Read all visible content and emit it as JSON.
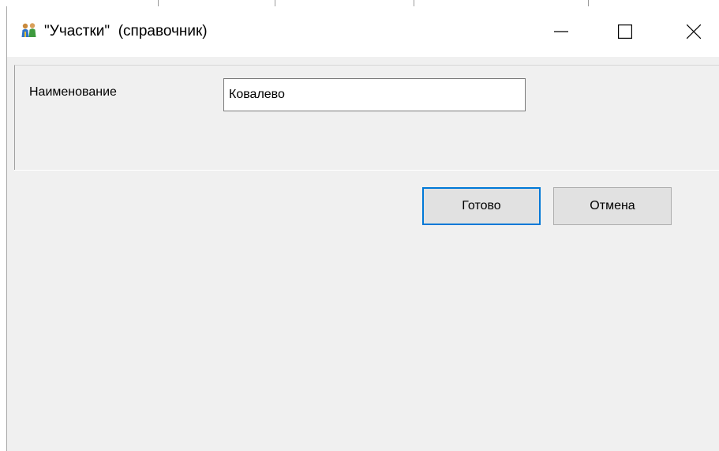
{
  "window": {
    "title": "\"Участки\"  (справочник)",
    "icon": "app-figures-icon",
    "controls": {
      "minimize": "minimize-icon",
      "maximize": "maximize-icon",
      "close": "close-icon"
    }
  },
  "form": {
    "name_label": "Наименование",
    "name_value": "Ковалево"
  },
  "buttons": {
    "ok_label": "Готово",
    "cancel_label": "Отмена"
  },
  "colors": {
    "focus_accent": "#0078d7",
    "dialog_background": "#f0f0f0",
    "titlebar_background": "#ffffff"
  }
}
